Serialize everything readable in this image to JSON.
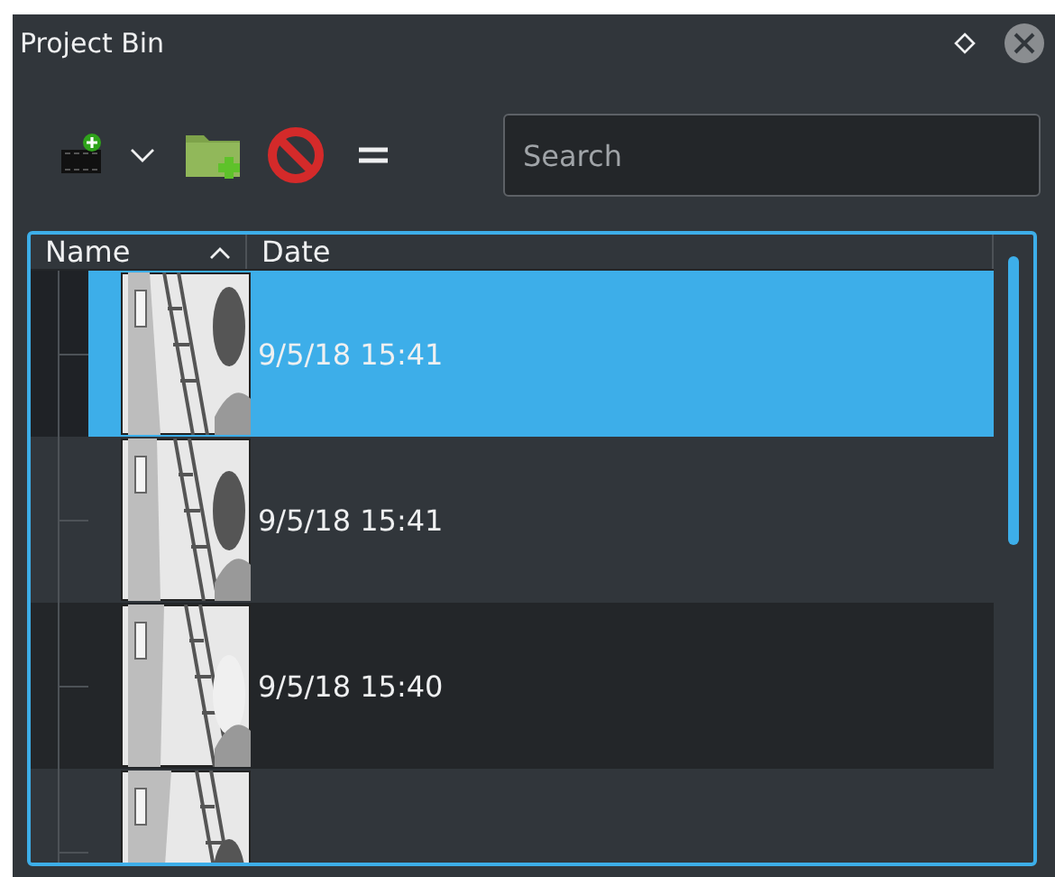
{
  "window": {
    "title": "Project Bin"
  },
  "search": {
    "placeholder": "Search"
  },
  "table": {
    "columns": [
      {
        "label": "Name",
        "sorted_ascending": true
      },
      {
        "label": "Date",
        "sorted_ascending": false
      }
    ],
    "rows": [
      {
        "date": "9/5/18 15:41",
        "selected": true
      },
      {
        "date": "9/5/18 15:41",
        "selected": false
      },
      {
        "date": "9/5/18 15:40",
        "selected": false
      },
      {
        "selected": false
      }
    ]
  }
}
